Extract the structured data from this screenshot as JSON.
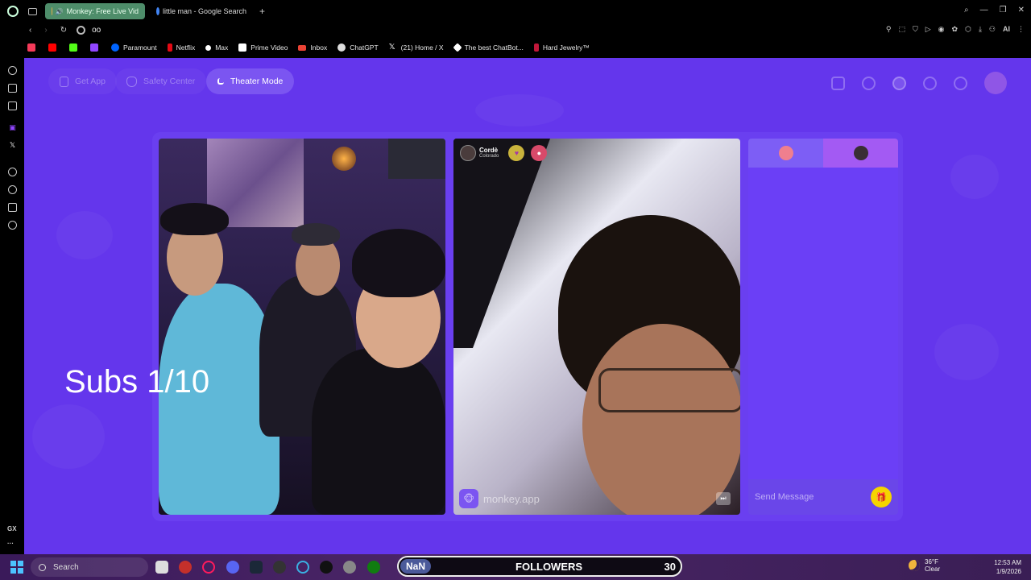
{
  "browser": {
    "tabs": [
      {
        "label": "Monkey: Free Live Vid",
        "active": true
      },
      {
        "label": "little man - Google Search",
        "active": false
      }
    ],
    "address": "oo",
    "ai_label": "AI",
    "bookmarks": [
      "Paramount",
      "Netflix",
      "Max",
      "Prime Video",
      "Inbox",
      "ChatGPT",
      "(21) Home / X",
      "The best ChatBot...",
      "Hard Jewelry™"
    ]
  },
  "sidebar": {
    "gx_label": "GX",
    "more": "···"
  },
  "app": {
    "topbar": {
      "get_app": "Get App",
      "safety_center": "Safety Center",
      "theater_mode": "Theater Mode"
    },
    "overlay_text": "Subs 1/10",
    "partner": {
      "name": "Cordè",
      "location": "Colorado"
    },
    "watermark": "monkey.app",
    "chat": {
      "placeholder": "Send Message"
    }
  },
  "taskbar": {
    "search_placeholder": "Search",
    "widget": {
      "nan": "NaN",
      "label": "FOLLOWERS",
      "count": "30"
    },
    "weather": {
      "temp": "36°F",
      "condition": "Clear"
    },
    "clock": {
      "time": "12:53 AM",
      "date": "1/9/2026"
    }
  },
  "colors": {
    "brand_purple": "#6436ec",
    "active_tab": "#4e8d6a",
    "gift_yellow": "#f5d400"
  }
}
